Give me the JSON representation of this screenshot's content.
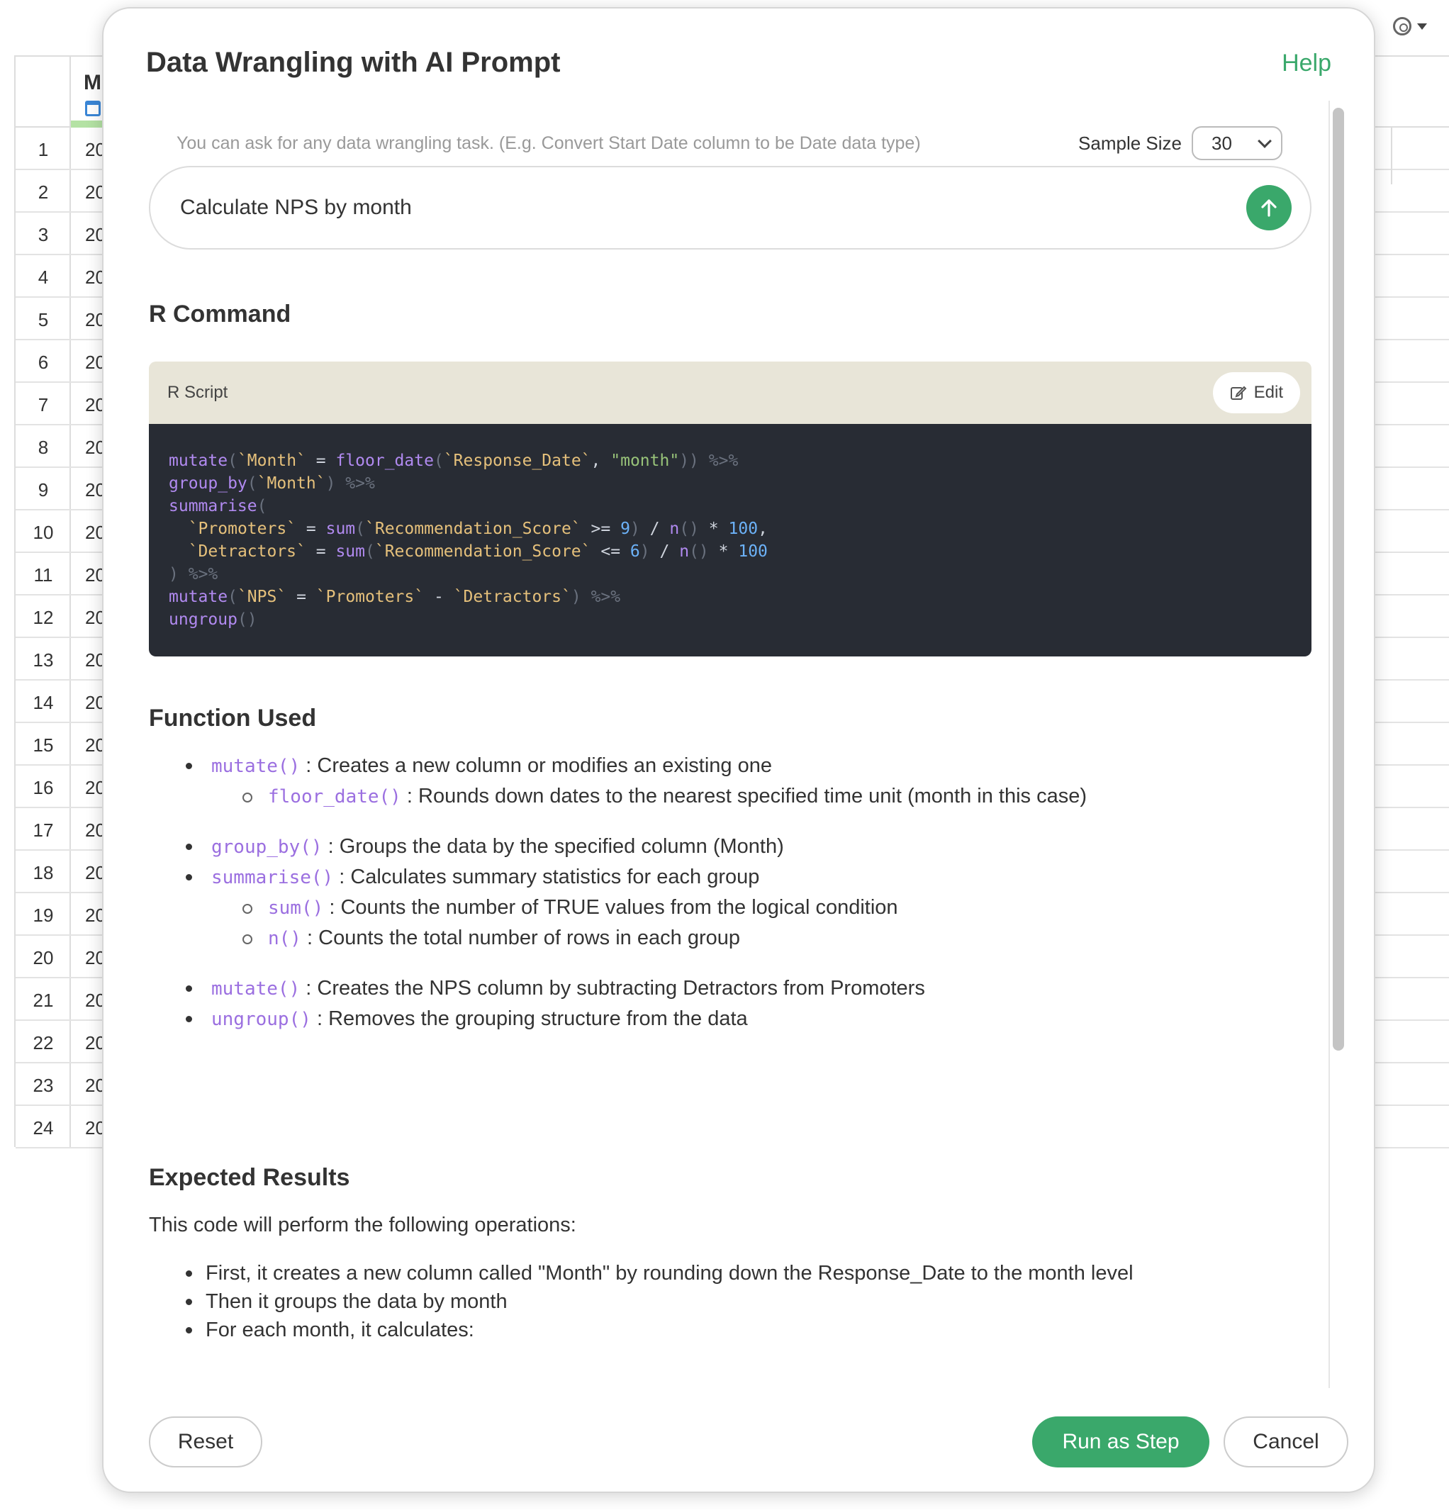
{
  "background": {
    "column_header": "M",
    "rows": [
      {
        "num": "1",
        "value": "20"
      },
      {
        "num": "2",
        "value": "20"
      },
      {
        "num": "3",
        "value": "20"
      },
      {
        "num": "4",
        "value": "20"
      },
      {
        "num": "5",
        "value": "20"
      },
      {
        "num": "6",
        "value": "20"
      },
      {
        "num": "7",
        "value": "20"
      },
      {
        "num": "8",
        "value": "20"
      },
      {
        "num": "9",
        "value": "20"
      },
      {
        "num": "10",
        "value": "20"
      },
      {
        "num": "11",
        "value": "20"
      },
      {
        "num": "12",
        "value": "20"
      },
      {
        "num": "13",
        "value": "20"
      },
      {
        "num": "14",
        "value": "20"
      },
      {
        "num": "15",
        "value": "20"
      },
      {
        "num": "16",
        "value": "20"
      },
      {
        "num": "17",
        "value": "20"
      },
      {
        "num": "18",
        "value": "20"
      },
      {
        "num": "19",
        "value": "20"
      },
      {
        "num": "20",
        "value": "20"
      },
      {
        "num": "21",
        "value": "20"
      },
      {
        "num": "22",
        "value": "20"
      },
      {
        "num": "23",
        "value": "20"
      },
      {
        "num": "24",
        "value": "20"
      }
    ],
    "settings_icon": "gear-icon"
  },
  "modal": {
    "title": "Data Wrangling with AI Prompt",
    "help_label": "Help",
    "hint": "You can ask for any data wrangling task. (E.g. Convert Start Date column to be Date data type)",
    "sample_size_label": "Sample Size",
    "sample_size_value": "30",
    "prompt_value": "Calculate NPS by month",
    "send_icon": "arrow-up-icon"
  },
  "r_command": {
    "heading": "R Command",
    "script_label": "R Script",
    "edit_label": "Edit"
  },
  "functions": {
    "heading": "Function Used",
    "items": [
      {
        "name": "mutate()",
        "desc": ": Creates a new column or modifies an existing one",
        "level": 1
      },
      {
        "name": "floor_date()",
        "desc": ": Rounds down dates to the nearest specified time unit (month in this case)",
        "level": 2
      },
      {
        "name": "group_by()",
        "desc": ": Groups the data by the specified column (Month)",
        "level": 1
      },
      {
        "name": "summarise()",
        "desc": ": Calculates summary statistics for each group",
        "level": 1
      },
      {
        "name": "sum()",
        "desc": ": Counts the number of TRUE values from the logical condition",
        "level": 2
      },
      {
        "name": "n()",
        "desc": ": Counts the total number of rows in each group",
        "level": 2
      },
      {
        "name": "mutate()",
        "desc": ": Creates the NPS column by subtracting Detractors from Promoters",
        "level": 1
      },
      {
        "name": "ungroup()",
        "desc": ": Removes the grouping structure from the data",
        "level": 1
      }
    ]
  },
  "results": {
    "heading": "Expected Results",
    "intro": "This code will perform the following operations:",
    "items": [
      "First, it creates a new column called \"Month\" by rounding down the Response_Date to the month level",
      "Then it groups the data by month",
      "For each month, it calculates:"
    ]
  },
  "footer": {
    "reset_label": "Reset",
    "run_label": "Run as Step",
    "cancel_label": "Cancel"
  },
  "colors": {
    "accent_green": "#3aa86b",
    "code_bg": "#282c34",
    "code_header_bg": "#e8e5d8",
    "function_purple": "#9b6fe0"
  }
}
